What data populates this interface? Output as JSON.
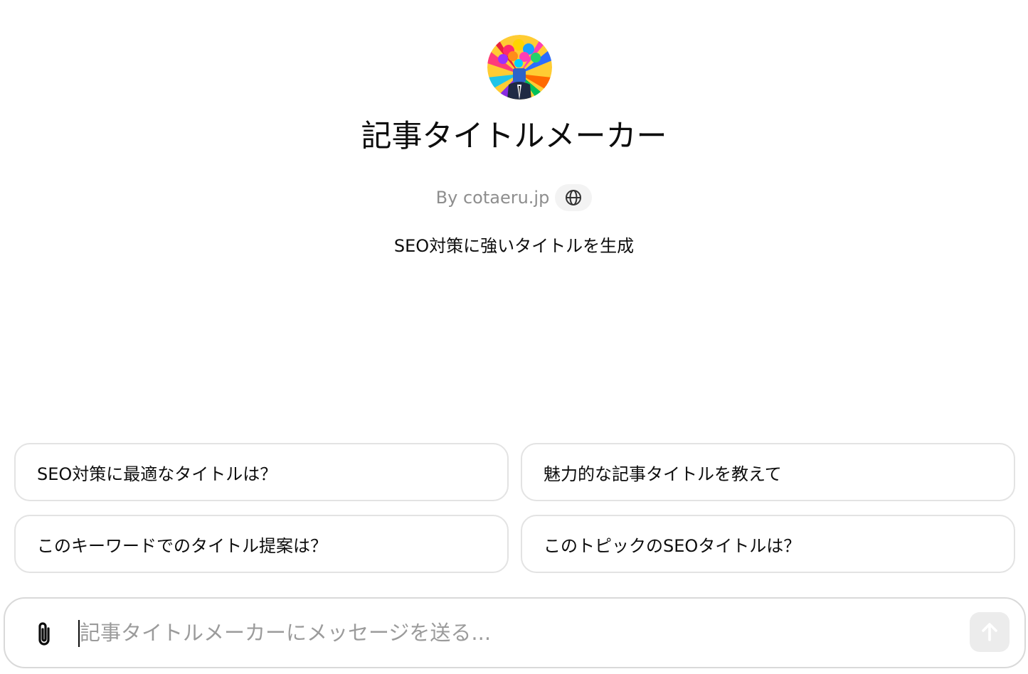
{
  "gpt": {
    "avatar_icon": "balloon-head-businessman-avatar",
    "title": "記事タイトルメーカー",
    "byline": "By cotaeru.jp",
    "website_icon": "globe-icon",
    "description": "SEO対策に強いタイトルを生成"
  },
  "starters": [
    {
      "label": "SEO対策に最適なタイトルは？"
    },
    {
      "label": "魅力的な記事タイトルを教えて"
    },
    {
      "label": "このキーワードでのタイトル提案は？"
    },
    {
      "label": "このトピックのSEOタイトルは？"
    }
  ],
  "composer": {
    "placeholder": "記事タイトルメーカーにメッセージを送る...",
    "value": "",
    "attach_icon": "paperclip-icon",
    "send_icon": "arrow-up-icon"
  },
  "colors": {
    "text": "#0d0d0d",
    "muted": "#8e8e8e",
    "border": "#e3e3e3",
    "send_disabled_bg": "#ececec"
  }
}
